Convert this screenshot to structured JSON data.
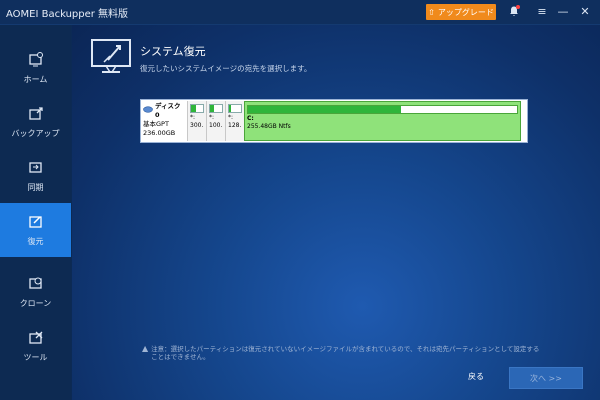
{
  "window": {
    "title": "AOMEI Backupper 無料版",
    "upgrade_label": "アップグレード"
  },
  "sidebar": {
    "items": [
      {
        "label": "ホーム",
        "icon": "home-icon"
      },
      {
        "label": "バックアップ",
        "icon": "backup-icon"
      },
      {
        "label": "同期",
        "icon": "sync-icon"
      },
      {
        "label": "復元",
        "icon": "restore-icon",
        "active": true
      },
      {
        "label": "クローン",
        "icon": "clone-icon"
      },
      {
        "label": "ツール",
        "icon": "tools-icon"
      }
    ]
  },
  "header": {
    "title": "システム復元",
    "subtitle": "復元したいシステムイメージの宛先を選択します。"
  },
  "disk": {
    "name": "ディスク0",
    "type": "基本GPT",
    "size": "236.00GB",
    "partitions": [
      {
        "label": "*:",
        "size": "300.",
        "used_fraction": 0.4
      },
      {
        "label": "*:",
        "size": "100.",
        "used_fraction": 0.3
      },
      {
        "label": "*:",
        "size": "128.",
        "used_fraction": 0.2
      },
      {
        "label": "C:",
        "size": "255.48GB Ntfs",
        "used_fraction": 0.57
      }
    ]
  },
  "warning": "注意：選択したパーティションは復元されていないイメージファイルが含まれているので、それは宛先パーティションとして設定することはできません。",
  "footer": {
    "back_label": "戻る",
    "next_label": "次へ >>"
  },
  "colors": {
    "accent": "#1e7be0",
    "upgrade": "#f08a1c",
    "partition_green": "#8fe27a"
  }
}
